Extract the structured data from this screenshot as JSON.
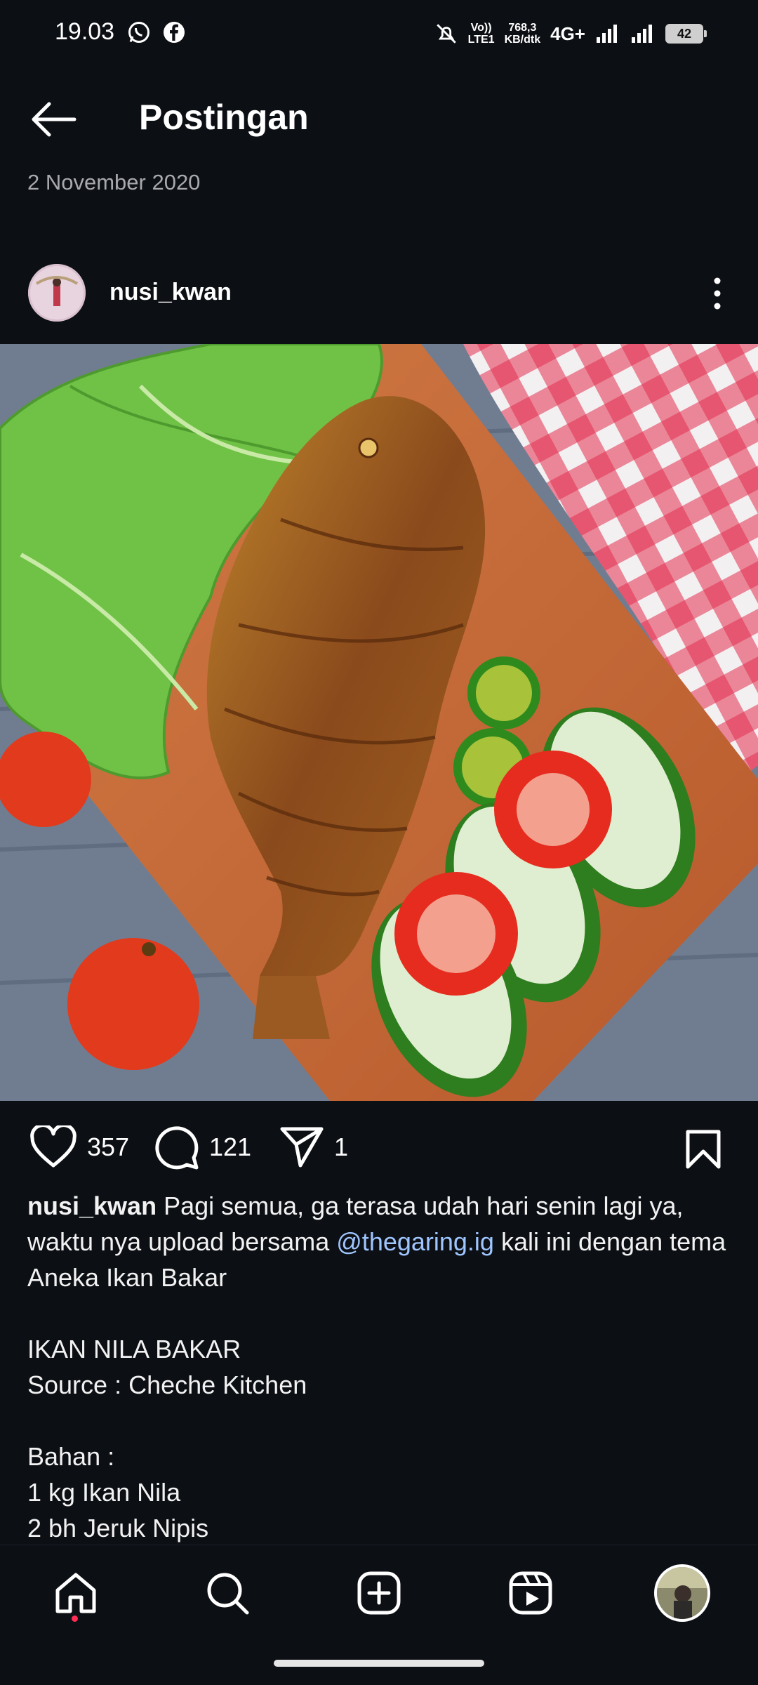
{
  "status_bar": {
    "time": "19.03",
    "network_line1": "Vo))",
    "network_line2": "LTE1",
    "speed_value": "768,3",
    "speed_unit": "KB/dtk",
    "network_type": "4G+",
    "battery": "42"
  },
  "header": {
    "title": "Postingan",
    "date": "2 November 2020"
  },
  "post": {
    "username": "nusi_kwan",
    "likes": "357",
    "comments": "121",
    "shares": "1",
    "caption": {
      "username": "nusi_kwan",
      "text_before_mention": " Pagi semua, ga terasa udah hari senin lagi ya, waktu nya upload bersama ",
      "mention": "@thegaring.ig",
      "text_after_mention": " kali ini dengan tema Aneka Ikan Bakar",
      "line_recipe_title": "IKAN NILA BAKAR",
      "line_source": "Source : Cheche Kitchen",
      "line_bahan": "Bahan :",
      "line_ingredient_1": "1 kg Ikan Nila",
      "line_ingredient_2": "2 bh Jeruk Nipis"
    }
  },
  "colors": {
    "background": "#0c0f14",
    "mention": "#9fc5ff",
    "nav_dot": "#ff2d55"
  },
  "icons": {
    "back": "arrow-left-icon",
    "more": "more-vertical-icon",
    "like": "heart-icon",
    "comment": "comment-icon",
    "share": "send-icon",
    "save": "bookmark-icon",
    "nav": [
      "home-icon",
      "search-icon",
      "add-icon",
      "reels-icon",
      "profile-avatar"
    ]
  }
}
